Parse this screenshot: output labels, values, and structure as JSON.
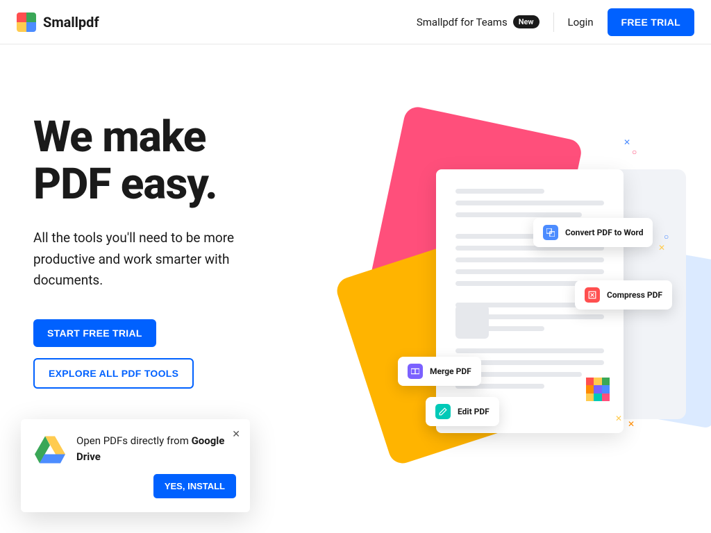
{
  "header": {
    "brand": "Smallpdf",
    "teams_link": "Smallpdf for Teams",
    "teams_badge": "New",
    "login": "Login",
    "cta": "FREE TRIAL"
  },
  "hero": {
    "title_line1": "We make",
    "title_line2": "PDF easy.",
    "subtitle": "All the tools you'll need to be more productive and work smarter with documents.",
    "primary_btn": "START FREE TRIAL",
    "secondary_btn": "EXPLORE ALL PDF TOOLS"
  },
  "chips": {
    "convert": "Convert PDF to Word",
    "compress": "Compress PDF",
    "merge": "Merge PDF",
    "edit": "Edit PDF"
  },
  "toast": {
    "text_prefix": "Open PDFs directly from ",
    "text_bold": "Google Drive",
    "install_btn": "YES, INSTALL"
  }
}
